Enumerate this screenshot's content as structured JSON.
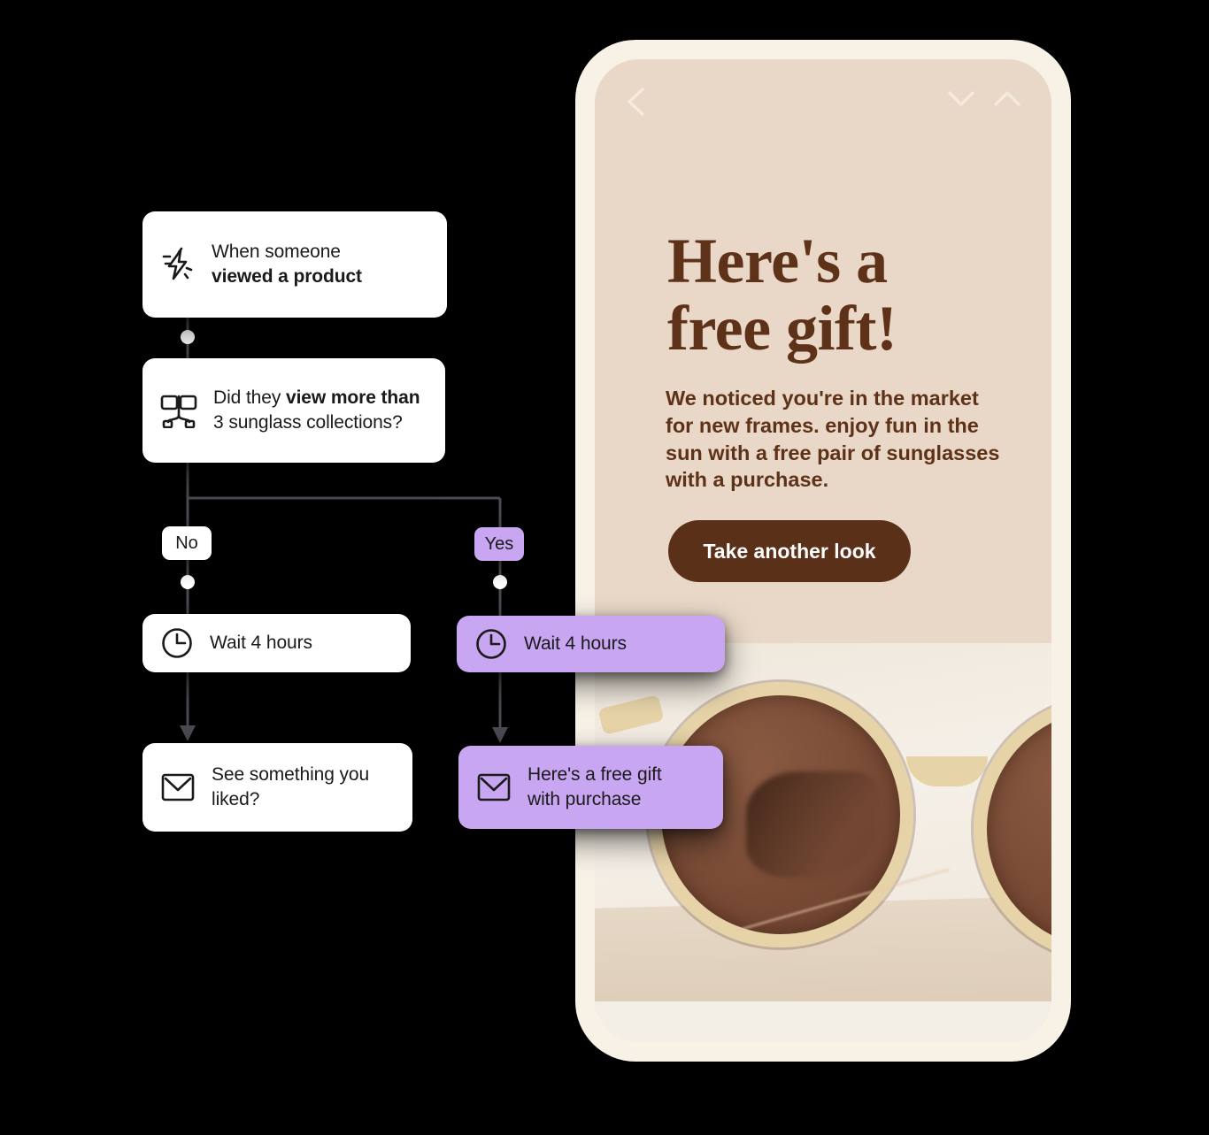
{
  "flow": {
    "nodes": [
      {
        "id": "trigger",
        "icon": "lightning-bolt-icon",
        "line1": "When someone",
        "line2": "viewed a product",
        "variant": "white"
      },
      {
        "id": "split",
        "icon": "split-branch-icon",
        "line1_plain": "Did they ",
        "line1_bold": "view more than",
        "line2": "3 sunglass collections?",
        "variant": "white"
      },
      {
        "id": "wait-no",
        "icon": "clock-icon",
        "label": "Wait 4 hours",
        "variant": "white"
      },
      {
        "id": "wait-yes",
        "icon": "clock-icon",
        "label": "Wait 4 hours",
        "variant": "purple"
      },
      {
        "id": "mail-no",
        "icon": "envelope-icon",
        "line1": "See something you",
        "line2": "liked?",
        "variant": "white"
      },
      {
        "id": "mail-yes",
        "icon": "envelope-icon",
        "line1": "Here's a free gift",
        "line2": "with purchase",
        "variant": "purple"
      }
    ],
    "branches": {
      "no_label": "No",
      "yes_label": "Yes"
    },
    "colors": {
      "card_white": "#ffffff",
      "card_purple": "#c8a6f2",
      "connector": "#4a4a52",
      "dot": "#ffffff",
      "background": "#000000"
    }
  },
  "phone": {
    "nav": {
      "back_icon": "chevron-left-icon",
      "down_icon": "chevron-down-icon",
      "up_icon": "chevron-up-icon"
    },
    "headline_line1": "Here's a",
    "headline_line2": "free gift!",
    "body": "We noticed you're in the market for new frames. enjoy fun in the sun with a free pair of sunglasses with a purchase.",
    "cta_label": "Take another look",
    "product_image_alt": "round cream-framed sunglasses with brown lenses",
    "colors": {
      "frame": "#f7f1e6",
      "screen_bg": "#e9d8c8",
      "text_brown": "#5d3218",
      "cta_bg": "#5b3018",
      "cta_text": "#ffffff"
    }
  }
}
